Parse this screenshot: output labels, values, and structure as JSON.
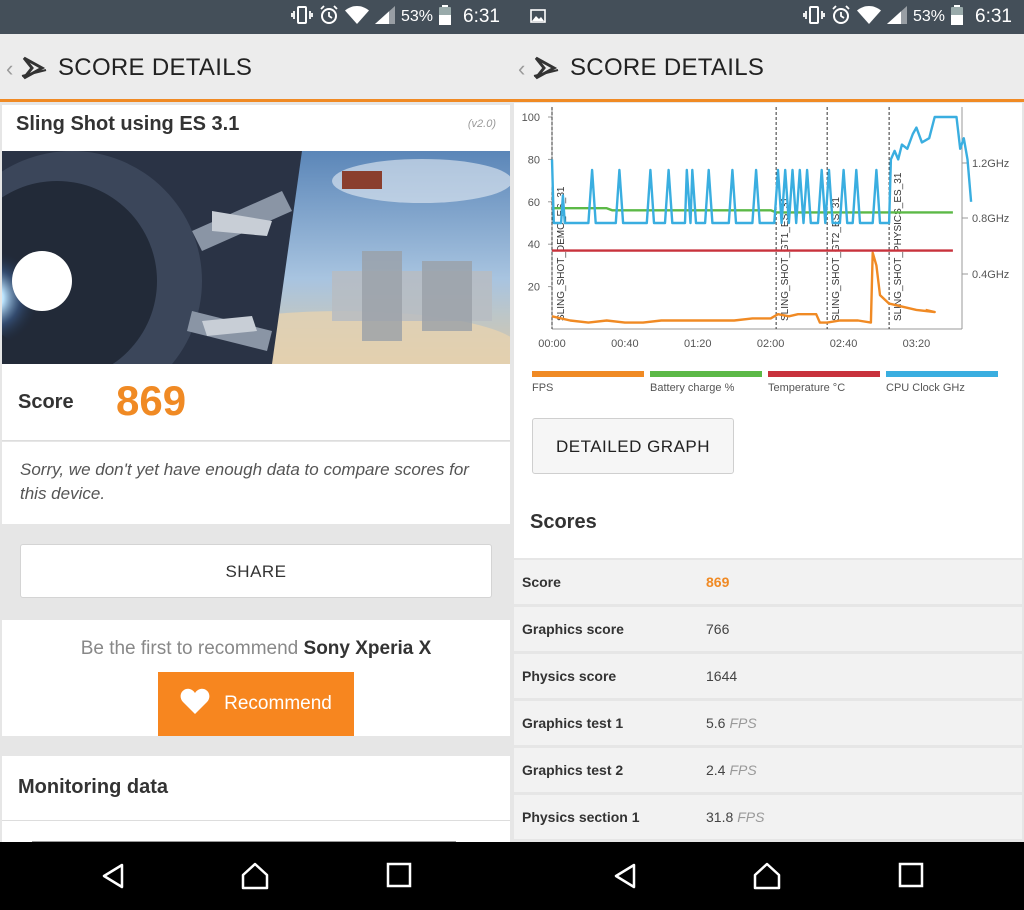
{
  "status": {
    "battery_pct": "53%",
    "time": "6:31"
  },
  "left": {
    "header_title": "SCORE DETAILS",
    "test_title": "Sling Shot using ES 3.1",
    "version": "(v2.0)",
    "score_label": "Score",
    "score_value": "869",
    "sorry_text": "Sorry, we don't yet have enough data to compare scores for this device.",
    "share_label": "SHARE",
    "recommend_prefix": "Be the first to recommend",
    "recommend_device": "Sony Xperia X",
    "recommend_button": "Recommend",
    "monitoring_title": "Monitoring data"
  },
  "right": {
    "header_title": "SCORE DETAILS",
    "detailed_graph_label": "DETAILED GRAPH",
    "scores_title": "Scores",
    "scores": [
      {
        "label": "Score",
        "value": "869",
        "unit": ""
      },
      {
        "label": "Graphics score",
        "value": "766",
        "unit": ""
      },
      {
        "label": "Physics score",
        "value": "1644",
        "unit": ""
      },
      {
        "label": "Graphics test 1",
        "value": "5.6",
        "unit": "FPS"
      },
      {
        "label": "Graphics test 2",
        "value": "2.4",
        "unit": "FPS"
      },
      {
        "label": "Physics section 1",
        "value": "31.8",
        "unit": "FPS"
      }
    ]
  },
  "chart_data": {
    "type": "line",
    "x_ticks": [
      "00:00",
      "00:40",
      "01:20",
      "02:00",
      "02:40",
      "03:20"
    ],
    "y_ticks": [
      20,
      40,
      60,
      80,
      100
    ],
    "y_right_ticks": [
      "0.4GHz",
      "0.8GHz",
      "1.2GHz"
    ],
    "xlim": [
      0,
      225
    ],
    "ylim": [
      0,
      100
    ],
    "phases": [
      {
        "label": "SLING_SHOT_DEMO_ES_31",
        "x": 0
      },
      {
        "label": "SLING_SHOT_GT1_ES_31",
        "x": 123
      },
      {
        "label": "SLING_SHOT_GT2_ES_31",
        "x": 151
      },
      {
        "label": "SLING_SHOT_PHYSICS_ES_31",
        "x": 185
      }
    ],
    "legend": [
      {
        "name": "FPS",
        "color": "#f08a24"
      },
      {
        "name": "Battery charge %",
        "color": "#5cb947"
      },
      {
        "name": "Temperature °C",
        "color": "#c8323c"
      },
      {
        "name": "CPU Clock GHz",
        "color": "#3aaee0"
      }
    ],
    "series": [
      {
        "name": "FPS",
        "color": "#f08a24",
        "points": [
          [
            0,
            6
          ],
          [
            10,
            4
          ],
          [
            20,
            3
          ],
          [
            30,
            4
          ],
          [
            40,
            3
          ],
          [
            50,
            3
          ],
          [
            60,
            4
          ],
          [
            70,
            4
          ],
          [
            80,
            4
          ],
          [
            90,
            4
          ],
          [
            100,
            4
          ],
          [
            110,
            5
          ],
          [
            120,
            5
          ],
          [
            124,
            7
          ],
          [
            130,
            6
          ],
          [
            135,
            7
          ],
          [
            145,
            7
          ],
          [
            147,
            3
          ],
          [
            151,
            3
          ],
          [
            158,
            4
          ],
          [
            168,
            4
          ],
          [
            175,
            3
          ],
          [
            176,
            36
          ],
          [
            178,
            30
          ],
          [
            180,
            16
          ],
          [
            185,
            12
          ],
          [
            195,
            10
          ],
          [
            200,
            9
          ],
          [
            210,
            8
          ],
          [
            205,
            9
          ]
        ]
      },
      {
        "name": "Battery charge %",
        "color": "#5cb947",
        "points": [
          [
            0,
            57
          ],
          [
            30,
            57
          ],
          [
            33,
            56
          ],
          [
            80,
            56
          ],
          [
            120,
            56
          ],
          [
            123,
            55
          ],
          [
            220,
            55
          ]
        ]
      },
      {
        "name": "Temperature °C",
        "color": "#c8323c",
        "points": [
          [
            0,
            37
          ],
          [
            220,
            37
          ]
        ]
      },
      {
        "name": "CPU Clock GHz",
        "color": "#3aaee0",
        "points": [
          [
            0,
            80
          ],
          [
            1,
            50
          ],
          [
            5,
            50
          ],
          [
            6,
            63
          ],
          [
            7,
            50
          ],
          [
            20,
            50
          ],
          [
            22,
            75
          ],
          [
            24,
            50
          ],
          [
            35,
            50
          ],
          [
            37,
            75
          ],
          [
            39,
            50
          ],
          [
            52,
            50
          ],
          [
            54,
            75
          ],
          [
            56,
            50
          ],
          [
            62,
            50
          ],
          [
            64,
            75
          ],
          [
            66,
            50
          ],
          [
            73,
            50
          ],
          [
            74,
            75
          ],
          [
            76,
            50
          ],
          [
            77,
            75
          ],
          [
            79,
            50
          ],
          [
            84,
            50
          ],
          [
            86,
            75
          ],
          [
            88,
            50
          ],
          [
            97,
            50
          ],
          [
            99,
            75
          ],
          [
            101,
            50
          ],
          [
            110,
            50
          ],
          [
            112,
            75
          ],
          [
            114,
            50
          ],
          [
            122,
            50
          ],
          [
            124,
            75
          ],
          [
            126,
            50
          ],
          [
            128,
            75
          ],
          [
            130,
            50
          ],
          [
            132,
            75
          ],
          [
            134,
            50
          ],
          [
            136,
            75
          ],
          [
            138,
            50
          ],
          [
            140,
            75
          ],
          [
            142,
            50
          ],
          [
            146,
            50
          ],
          [
            148,
            75
          ],
          [
            150,
            50
          ],
          [
            152,
            75
          ],
          [
            154,
            50
          ],
          [
            158,
            50
          ],
          [
            160,
            75
          ],
          [
            162,
            50
          ],
          [
            165,
            50
          ],
          [
            167,
            75
          ],
          [
            169,
            50
          ],
          [
            176,
            50
          ],
          [
            178,
            75
          ],
          [
            180,
            50
          ],
          [
            185,
            50
          ],
          [
            186,
            80
          ],
          [
            188,
            84
          ],
          [
            190,
            80
          ],
          [
            192,
            87
          ],
          [
            195,
            85
          ],
          [
            198,
            92
          ],
          [
            200,
            95
          ],
          [
            203,
            88
          ],
          [
            207,
            90
          ],
          [
            210,
            100
          ],
          [
            222,
            100
          ],
          [
            224,
            85
          ],
          [
            226,
            90
          ],
          [
            228,
            80
          ],
          [
            230,
            60
          ]
        ]
      }
    ]
  }
}
